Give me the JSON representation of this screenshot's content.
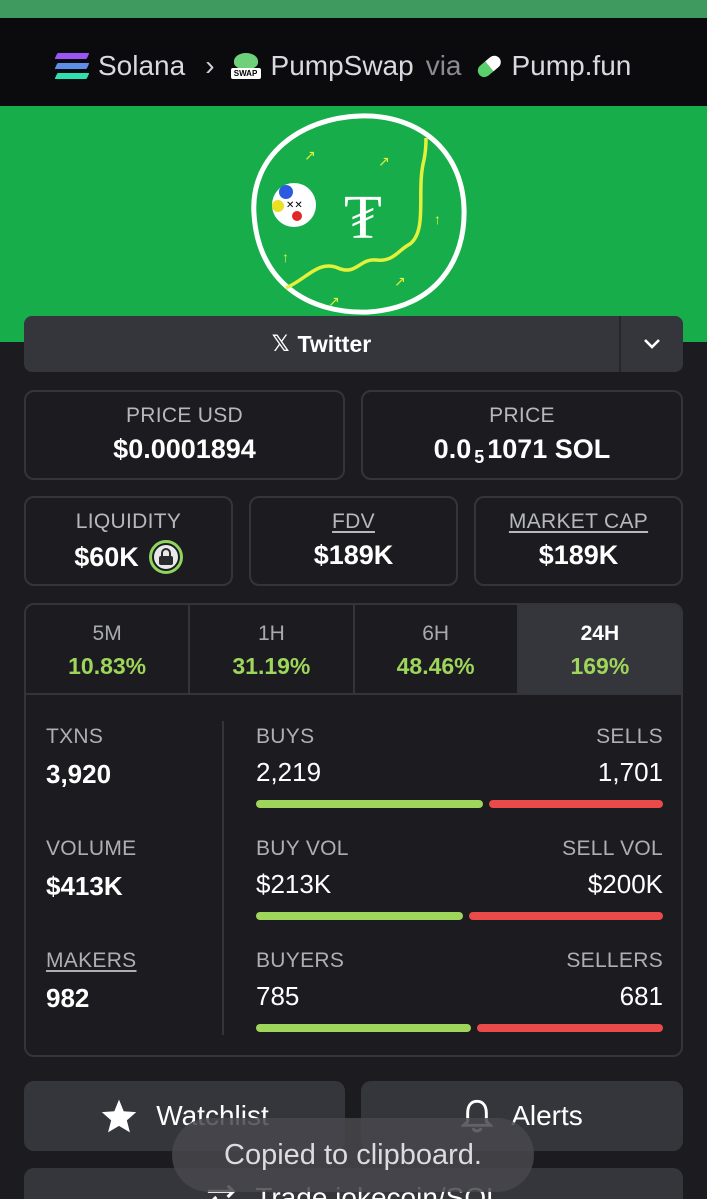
{
  "breadcrumb": {
    "chain": "Solana",
    "dex": "PumpSwap",
    "via": "via",
    "launchpad": "Pump.fun"
  },
  "socials": {
    "primary": "Twitter"
  },
  "prices": {
    "price_usd_label": "PRICE USD",
    "price_usd": "$0.0001894",
    "price_label": "PRICE",
    "price_sol_lead": "0.0",
    "price_sol_zeros": "5",
    "price_sol_tail": "1071 SOL"
  },
  "metrics": {
    "liquidity_label": "LIQUIDITY",
    "liquidity": "$60K",
    "fdv_label": "FDV",
    "fdv": "$189K",
    "mcap_label": "MARKET CAP",
    "mcap": "$189K"
  },
  "timeframes": [
    {
      "label": "5M",
      "change": "10.83%"
    },
    {
      "label": "1H",
      "change": "31.19%"
    },
    {
      "label": "6H",
      "change": "48.46%"
    },
    {
      "label": "24H",
      "change": "169%"
    }
  ],
  "active_timeframe": "24H",
  "txns": {
    "label": "TXNS",
    "value": "3,920",
    "buys_label": "BUYS",
    "buys": "2,219",
    "buy_share": 0.566,
    "sells_label": "SELLS",
    "sells": "1,701"
  },
  "volume": {
    "label": "VOLUME",
    "value": "$413K",
    "buy_label": "BUY VOL",
    "buy": "$213K",
    "buy_share": 0.516,
    "sell_label": "SELL VOL",
    "sell": "$200K"
  },
  "makers": {
    "label": "MAKERS",
    "value": "982",
    "buyers_label": "BUYERS",
    "buyers": "785",
    "buyer_share": 0.535,
    "sellers_label": "SELLERS",
    "sellers": "681"
  },
  "actions": {
    "watchlist": "Watchlist",
    "alerts": "Alerts",
    "trade": "Trade jokecoin/SOL"
  },
  "toast": "Copied to clipboard.",
  "colors": {
    "banner": "#16ad4a",
    "positive": "#9ed55b",
    "negative": "#ea4a4a",
    "panel": "#35363c",
    "background": "#1c1c20"
  }
}
